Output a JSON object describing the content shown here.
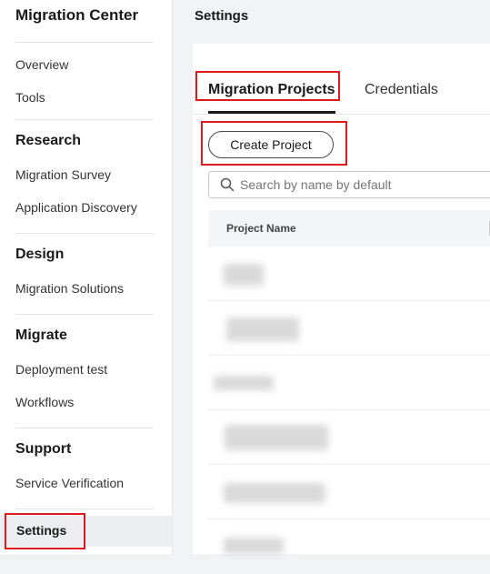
{
  "sidebar": {
    "app_title": "Migration Center",
    "items": [
      {
        "label": "Overview"
      },
      {
        "label": "Tools"
      }
    ],
    "groups": [
      {
        "title": "Research",
        "items": [
          {
            "label": "Migration Survey"
          },
          {
            "label": "Application Discovery"
          }
        ]
      },
      {
        "title": "Design",
        "items": [
          {
            "label": "Migration Solutions"
          }
        ]
      },
      {
        "title": "Migrate",
        "items": [
          {
            "label": "Deployment test"
          },
          {
            "label": "Workflows"
          }
        ]
      },
      {
        "title": "Support",
        "items": [
          {
            "label": "Service Verification"
          }
        ]
      }
    ],
    "active_item": {
      "label": "Settings"
    }
  },
  "header": {
    "title": "Settings"
  },
  "tabs": [
    {
      "label": "Migration Projects",
      "active": true
    },
    {
      "label": "Credentials",
      "active": false
    }
  ],
  "actions": {
    "create_project": "Create Project"
  },
  "search": {
    "placeholder": "Search by name by default",
    "value": ""
  },
  "table": {
    "columns": [
      "Project Name"
    ],
    "rows": [
      "",
      "",
      "",
      "",
      "",
      ""
    ]
  },
  "colors": {
    "highlight": "#e0191f",
    "active_tab": "#1a1a1a"
  }
}
